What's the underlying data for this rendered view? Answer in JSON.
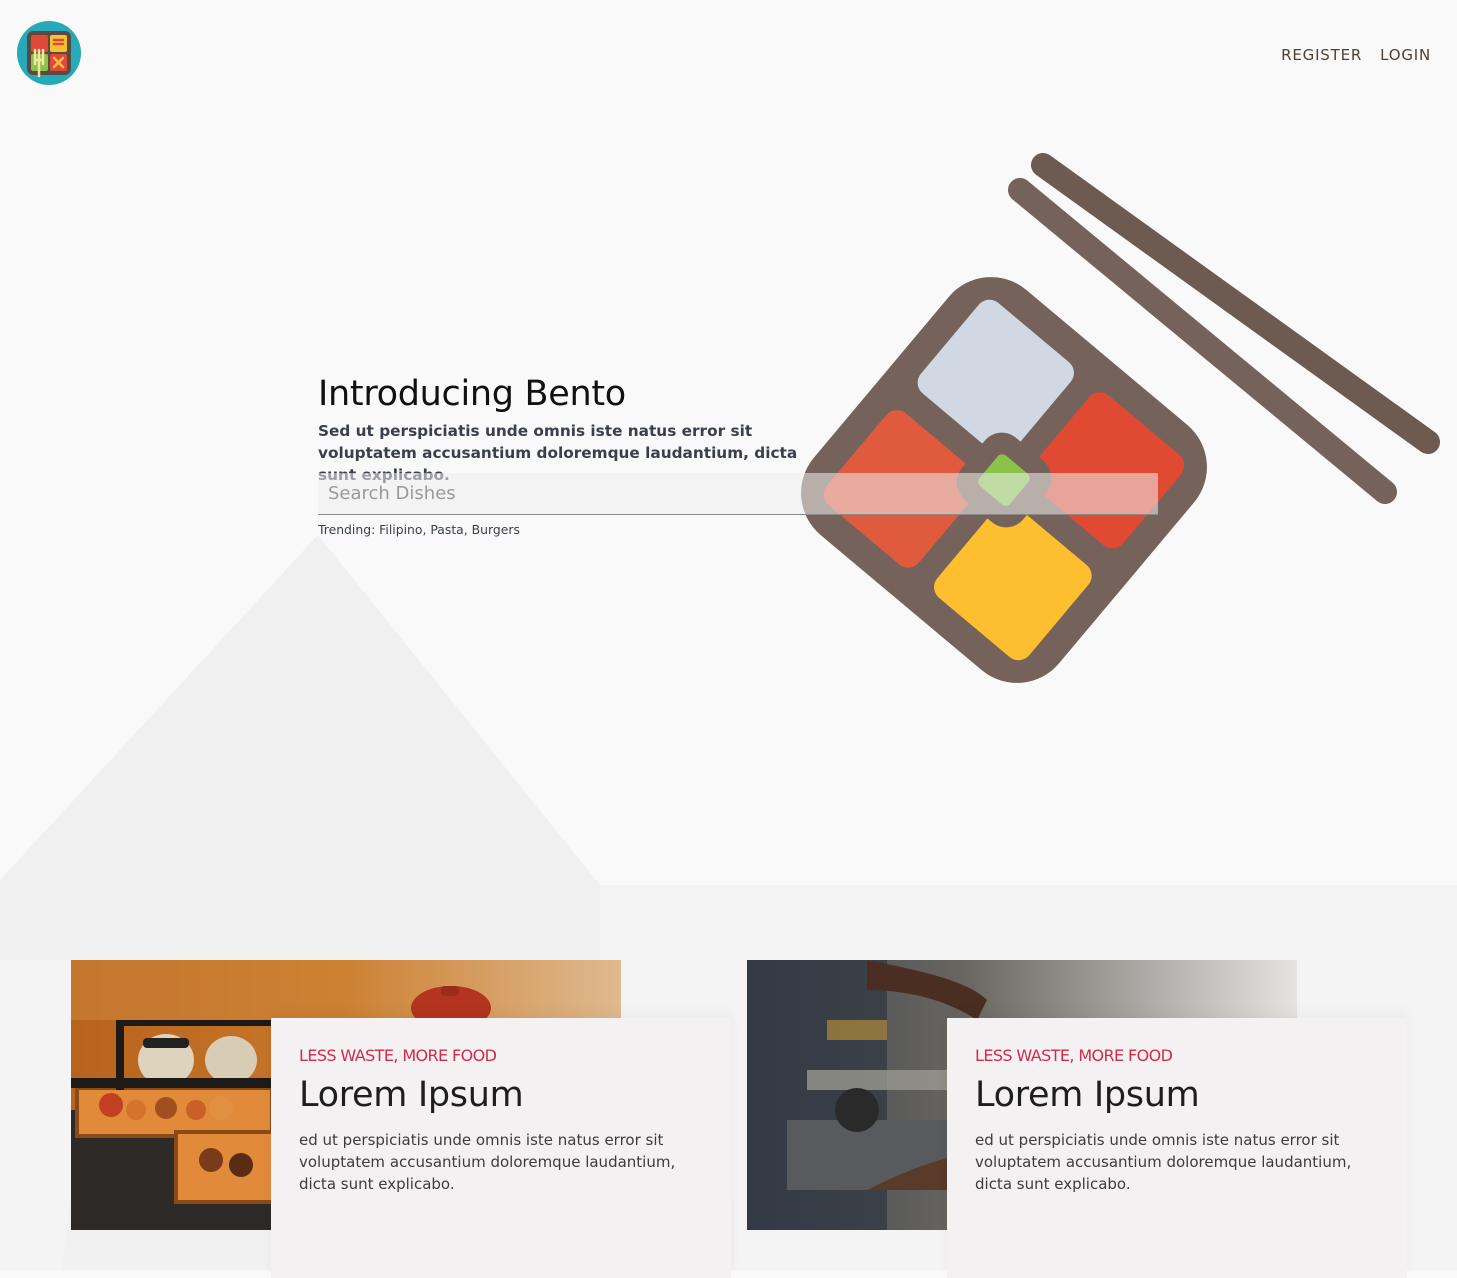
{
  "nav": {
    "register": "REGISTER",
    "login": "LOGIN"
  },
  "hero": {
    "title": "Introducing Bento",
    "subtitle": "Sed ut perspiciatis unde omnis iste natus error sit voluptatem accusantium doloremque laudantium, dicta sunt explicabo.",
    "search_placeholder": "Search Dishes",
    "trending": "Trending: Filipino, Pasta, Burgers"
  },
  "cards": [
    {
      "tag": "LESS WASTE, MORE FOOD",
      "title": "Lorem Ipsum",
      "text": "ed ut perspiciatis unde omnis iste natus error sit voluptatem accusantium doloremque laudantium, dicta sunt explicabo."
    },
    {
      "tag": "LESS WASTE, MORE FOOD",
      "title": "Lorem Ipsum",
      "text": "ed ut perspiciatis unde omnis iste natus error sit voluptatem accusantium doloremque laudantium, dicta sunt explicabo."
    }
  ],
  "colors": {
    "background": "#f9f9f9",
    "accent": "#d22a4a",
    "nav_text": "#4e3f33",
    "bento_brown": "#6d5a50",
    "bento_blue": "#cdd8e3",
    "bento_red": "#e05038",
    "bento_yellow": "#fdc02f",
    "bento_green": "#8bc34a"
  },
  "icons": [
    "bento-logo-icon",
    "bento-box-illustration",
    "chopsticks-illustration"
  ]
}
